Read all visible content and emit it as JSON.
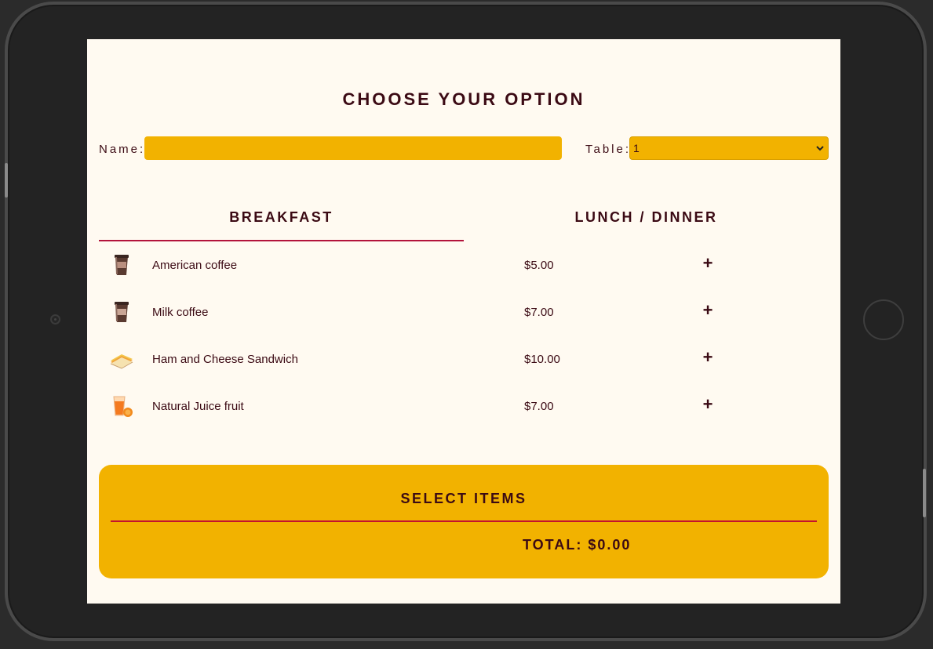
{
  "page_title": "CHOOSE YOUR OPTION",
  "form": {
    "name_label": "Name:",
    "name_value": "",
    "table_label": "Table:",
    "table_selected": "1"
  },
  "tabs": [
    {
      "label": "BREAKFAST",
      "active": true
    },
    {
      "label": "LUNCH / DINNER",
      "active": false
    }
  ],
  "menu_items": [
    {
      "name": "American coffee",
      "price": "$5.00",
      "icon": "coffee-cup-icon",
      "add": "+"
    },
    {
      "name": "Milk coffee",
      "price": "$7.00",
      "icon": "coffee-cup-icon",
      "add": "+"
    },
    {
      "name": "Ham and Cheese Sandwich",
      "price": "$10.00",
      "icon": "sandwich-icon",
      "add": "+"
    },
    {
      "name": "Natural Juice fruit",
      "price": "$7.00",
      "icon": "juice-icon",
      "add": "+"
    }
  ],
  "summary": {
    "title": "SELECT ITEMS",
    "total": "TOTAL: $0.00"
  },
  "colors": {
    "accent": "#f2b200",
    "text": "#3b0a14",
    "divider": "#b3133b",
    "background": "#fffaf1"
  }
}
